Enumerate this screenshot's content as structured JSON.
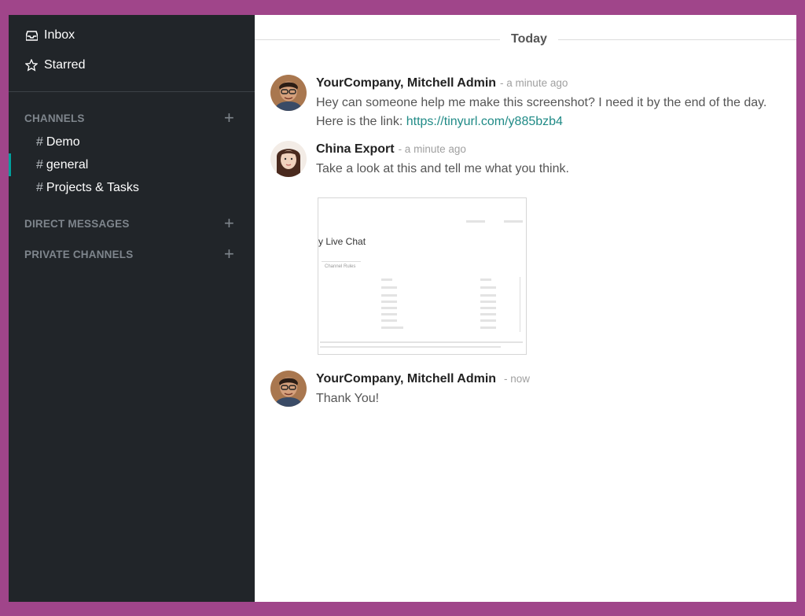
{
  "sidebar": {
    "mailboxes": [
      {
        "label": "Inbox",
        "icon": "inbox-icon"
      },
      {
        "label": "Starred",
        "icon": "star-icon"
      }
    ],
    "channels_header": "CHANNELS",
    "channels": [
      {
        "label": "Demo",
        "active": false
      },
      {
        "label": "general",
        "active": true
      },
      {
        "label": "Projects & Tasks",
        "active": false
      }
    ],
    "direct_messages_header": "DIRECT MESSAGES",
    "private_channels_header": "PRIVATE CHANNELS",
    "accent_color": "#00a09d"
  },
  "thread": {
    "day_separator": "Today",
    "messages": [
      {
        "author": "YourCompany, Mitchell Admin",
        "time": "- a minute ago",
        "line1": "Hey can someone help me make this screenshot? I need it by the end of the day.",
        "line2_prefix": "Here is the link: ",
        "link": "https://tinyurl.com/y885bzb4"
      },
      {
        "author": "China Export",
        "time": "- a minute ago",
        "text": "Take a look at this and tell me what you think.",
        "attachment": {
          "title": "y Live Chat",
          "tab": "Channel Rules"
        }
      },
      {
        "author": "YourCompany, Mitchell Admin",
        "time": "- now",
        "text": "Thank You!"
      }
    ]
  }
}
